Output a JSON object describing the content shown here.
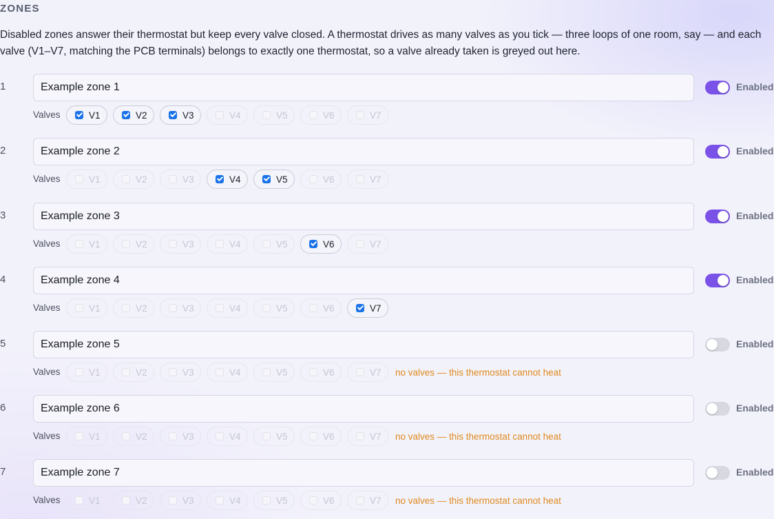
{
  "section": {
    "title": "ZONES",
    "intro": "Disabled zones answer their thermostat but keep every valve closed. A thermostat drives as many valves as you tick — three loops of one room, say — and each valve (V1–V7, matching the PCB terminals) belongs to exactly one thermostat, so a valve already taken is greyed out here."
  },
  "colors": {
    "accent": "#7b52e8",
    "checkbox": "#1a73e8",
    "warning": "#e08a1e"
  },
  "valves_label": "Valves",
  "enabled_label": "Enabled",
  "valve_names": [
    "V1",
    "V2",
    "V3",
    "V4",
    "V5",
    "V6",
    "V7"
  ],
  "zones": [
    {
      "number": "1",
      "name": "Example zone 1",
      "enabled": true,
      "valves": [
        "V1",
        "V2",
        "V3"
      ],
      "warning": ""
    },
    {
      "number": "2",
      "name": "Example zone 2",
      "enabled": true,
      "valves": [
        "V4",
        "V5"
      ],
      "warning": ""
    },
    {
      "number": "3",
      "name": "Example zone 3",
      "enabled": true,
      "valves": [
        "V6"
      ],
      "warning": ""
    },
    {
      "number": "4",
      "name": "Example zone 4",
      "enabled": true,
      "valves": [
        "V7"
      ],
      "warning": ""
    },
    {
      "number": "5",
      "name": "Example zone 5",
      "enabled": false,
      "valves": [],
      "warning": "no valves — this thermostat cannot heat"
    },
    {
      "number": "6",
      "name": "Example zone 6",
      "enabled": false,
      "valves": [],
      "warning": "no valves — this thermostat cannot heat"
    },
    {
      "number": "7",
      "name": "Example zone 7",
      "enabled": false,
      "valves": [],
      "warning": "no valves — this thermostat cannot heat"
    }
  ]
}
